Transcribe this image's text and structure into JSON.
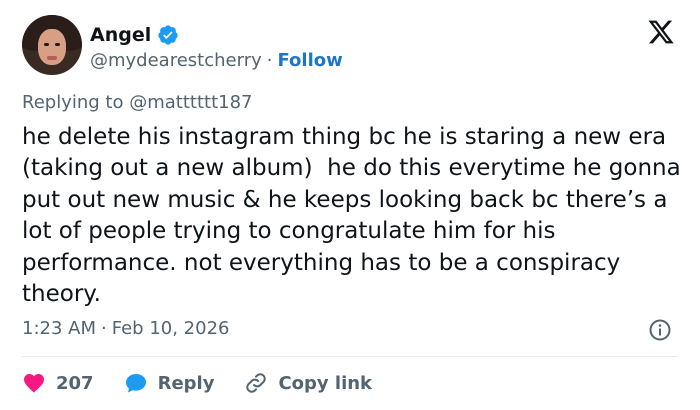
{
  "author": {
    "name": "Angel",
    "handle": "@mydearestcherry",
    "separator": "·",
    "follow_label": "Follow"
  },
  "replying": {
    "prefix": "Replying to",
    "mention": "@matttttt187"
  },
  "tweet": {
    "text": "he delete his instagram thing bc he is staring a new era (taking out a new album)  he do this everytime he gonna put out new music & he keeps looking back bc there’s a lot of people trying to congratulate him for his performance. not everything has to be a conspiracy theory."
  },
  "meta": {
    "time": "1:23 AM",
    "separator": "·",
    "date": "Feb 10, 2026"
  },
  "actions": {
    "like_count": "207",
    "reply_label": "Reply",
    "copy_label": "Copy link"
  },
  "icons": {
    "verified": "verified-badge-icon",
    "logo": "x-logo-icon",
    "info": "info-icon",
    "like": "heart-icon",
    "reply": "speech-bubble-icon",
    "copy": "link-icon"
  },
  "colors": {
    "verified": "#1d9bf0",
    "follow": "#1d76c8",
    "like": "#f91880",
    "reply": "#1d9bf0",
    "secondary_text": "#536471"
  }
}
